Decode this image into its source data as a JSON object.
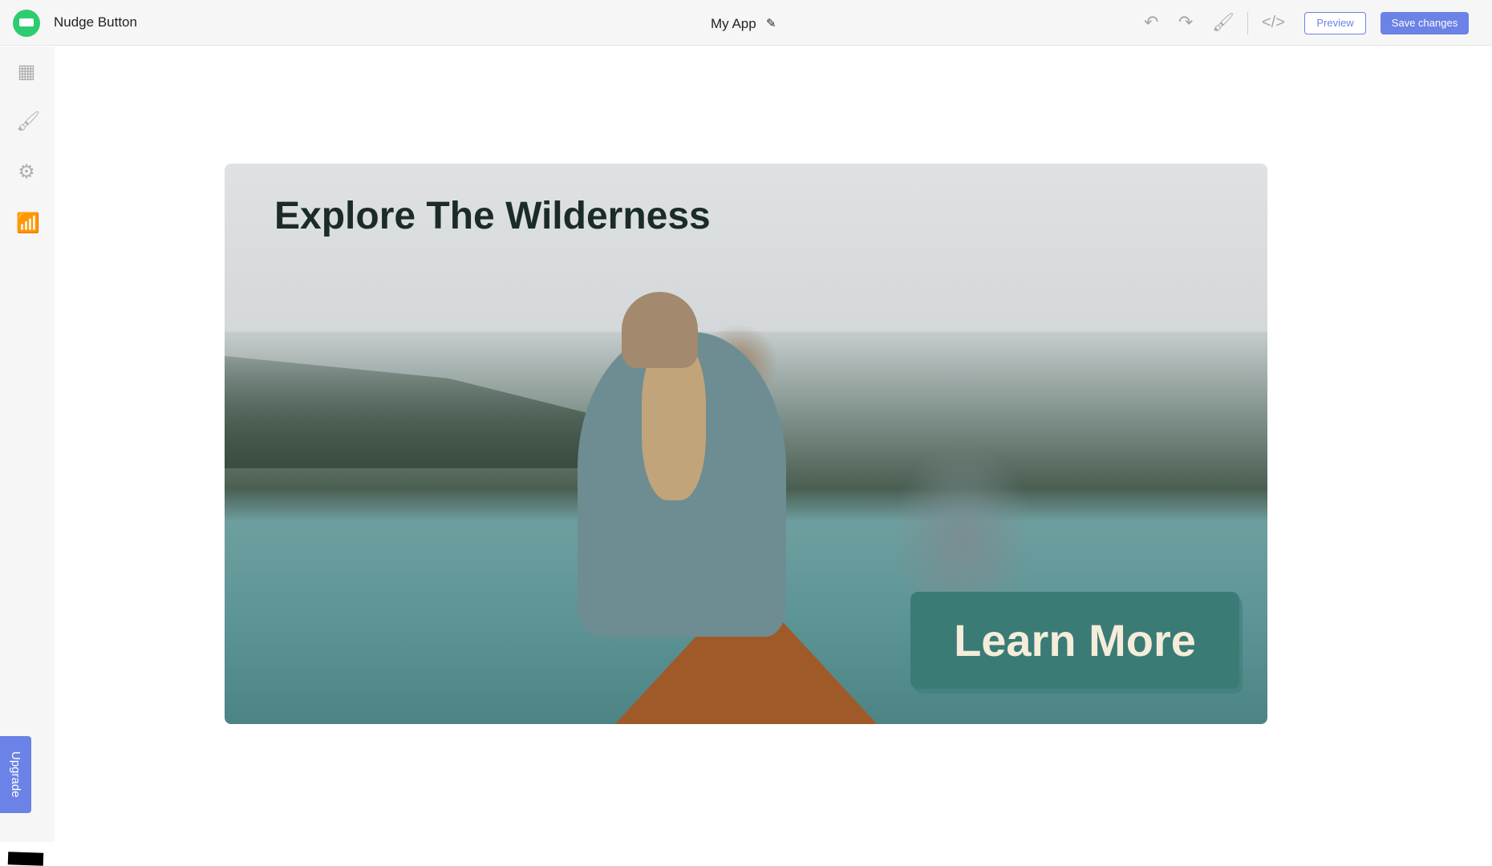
{
  "header": {
    "app_name": "Nudge Button",
    "project_title": "My App",
    "preview_label": "Preview",
    "save_label": "Save changes"
  },
  "sidebar": {
    "items": [
      {
        "icon": "layout-icon"
      },
      {
        "icon": "brush-icon"
      },
      {
        "icon": "gear-icon"
      },
      {
        "icon": "analytics-icon"
      }
    ],
    "upgrade_label": "Upgrade"
  },
  "widget": {
    "title": "Explore The Wilderness",
    "button_label": "Learn More",
    "button_color": "#3a7b76"
  },
  "colors": {
    "accent": "#6b82e6",
    "logo": "#2ecc71"
  }
}
